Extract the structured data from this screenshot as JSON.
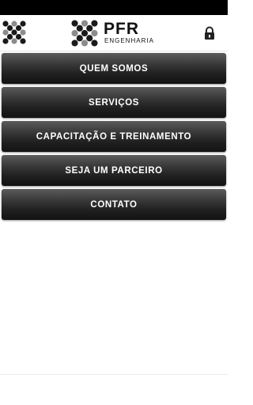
{
  "app": {
    "brand_name": "PFR",
    "brand_subtitle": "ENGENHARIA",
    "icons": {
      "left": "pfr-logo-icon",
      "right": "lock-icon"
    }
  },
  "menu": {
    "items": [
      {
        "label": "QUEM SOMOS"
      },
      {
        "label": "SERVIÇOS"
      },
      {
        "label": "CAPACITAÇÃO E TREINAMENTO"
      },
      {
        "label": "SEJA UM PARCEIRO"
      },
      {
        "label": "CONTATO"
      }
    ]
  },
  "colors": {
    "status_bar": "#000000",
    "button_top": "#5b5b5b",
    "button_bottom": "#121212",
    "button_text": "#ffffff",
    "logo_gray": "#8c8c8c"
  }
}
